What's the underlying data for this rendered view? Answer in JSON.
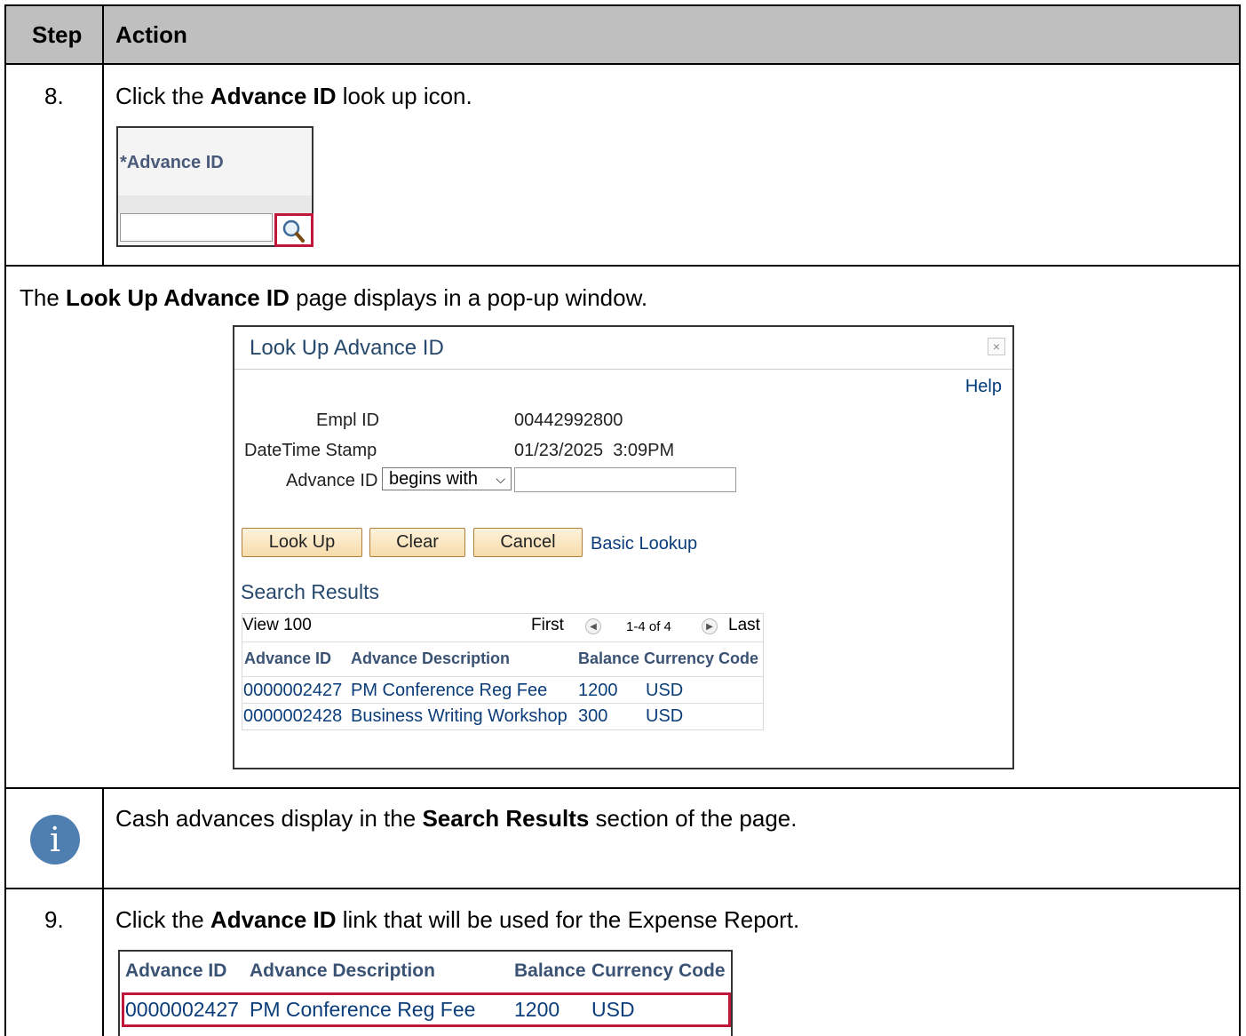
{
  "header": {
    "step": "Step",
    "action": "Action"
  },
  "step8": {
    "num": "8.",
    "pre": "Click the ",
    "bold": "Advance ID",
    "post": " look up icon.",
    "snippet_label": "*Advance ID"
  },
  "popup_intro": {
    "pre": "The ",
    "bold": "Look Up Advance ID",
    "post": " page displays in a pop-up window."
  },
  "popup": {
    "title": "Look Up Advance ID",
    "close": "×",
    "help": "Help",
    "empl_label": "Empl ID",
    "empl_value": "00442992800",
    "dts_label": "DateTime Stamp",
    "dts_value": "01/23/2025  3:09PM",
    "adv_label": "Advance ID",
    "operator": "begins with",
    "buttons": {
      "lookup": "Look Up",
      "clear": "Clear",
      "cancel": "Cancel"
    },
    "basic_lookup": "Basic Lookup",
    "search_results": "Search Results",
    "view": "View 100",
    "first": "First",
    "range": "1-4 of 4",
    "last": "Last",
    "columns": [
      "Advance ID",
      "Advance Description",
      "Balance",
      "Currency Code"
    ],
    "rows": [
      [
        "0000002427",
        "PM Conference Reg Fee",
        "1200",
        "USD"
      ],
      [
        "0000002428",
        "Business Writing Workshop",
        "300",
        "USD"
      ]
    ]
  },
  "note": {
    "pre": "Cash advances display in the ",
    "bold": "Search Results",
    "post": " section of the page."
  },
  "step9": {
    "num": "9.",
    "pre": "Click the ",
    "bold": "Advance ID",
    "post": " link that will be used for the Expense Report.",
    "columns": [
      "Advance ID",
      "Advance Description",
      "Balance",
      "Currency Code"
    ],
    "row": [
      "0000002427",
      "PM Conference Reg Fee",
      "1200",
      "USD"
    ]
  },
  "colors": {
    "header_bg": "#bfbfbf",
    "highlight": "#c0163a",
    "link": "#0b3d7a",
    "info": "#4f7fb0"
  }
}
